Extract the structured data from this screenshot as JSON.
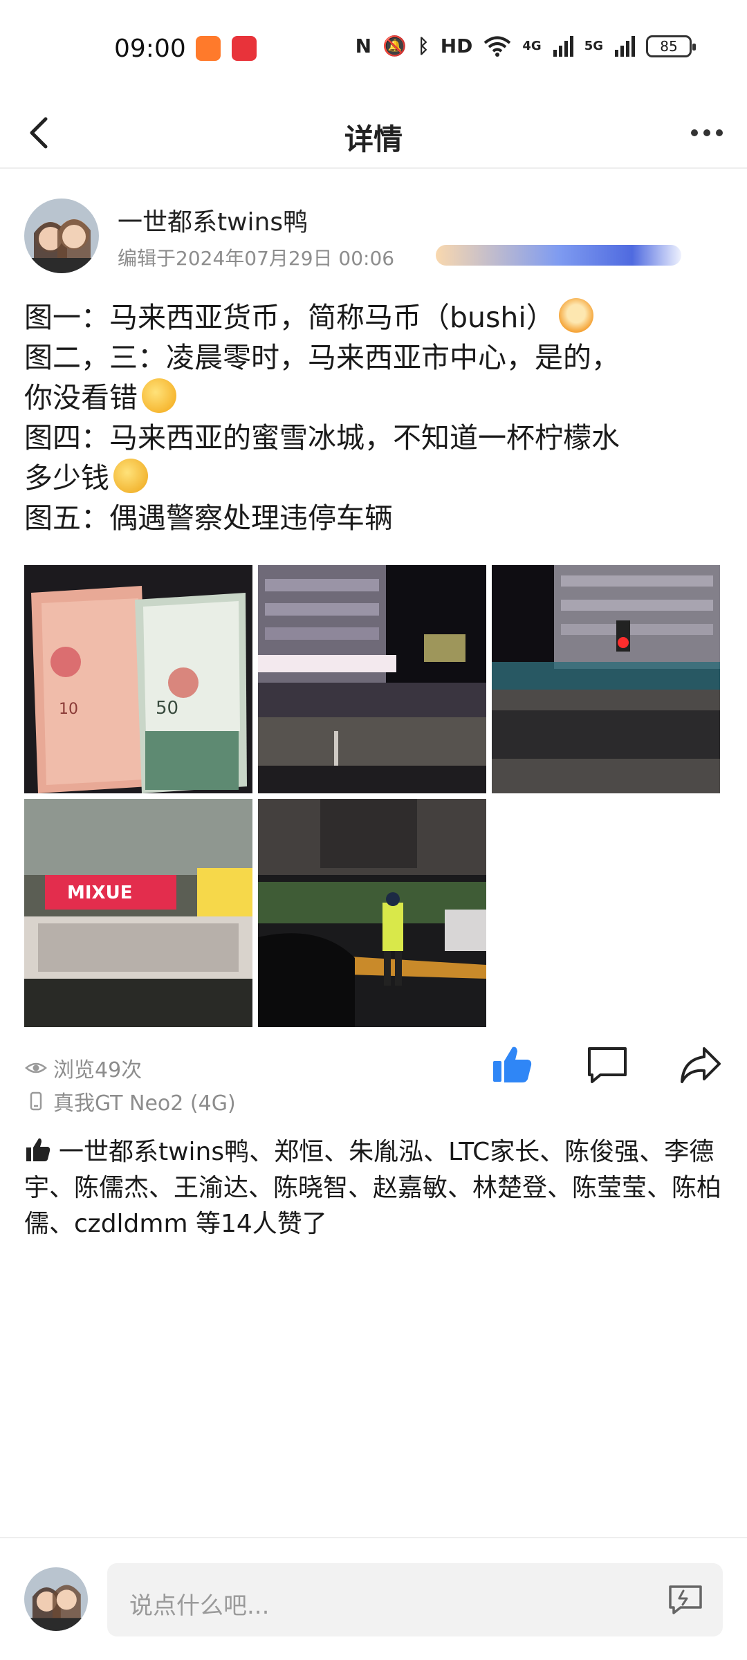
{
  "status_bar": {
    "time": "09:00",
    "network1": "4G",
    "network2": "5G",
    "hd": "HD",
    "battery": "85"
  },
  "nav": {
    "title": "详情"
  },
  "post": {
    "author": "一世都系twins鸭",
    "edit_time": "编辑于2024年07月29日 00:06",
    "lines": [
      "图一：马来西亚货币，简称马币（bushi）",
      "图二，三：凌晨零时，马来西亚市中心，是的，",
      "你没看错",
      "图四：马来西亚的蜜雪冰城，不知道一杯柠檬水",
      "多少钱",
      "图五：偶遇警察处理违停车辆"
    ],
    "photos": [
      {
        "name": "photo-malaysian-currency"
      },
      {
        "name": "photo-city-center-night-1"
      },
      {
        "name": "photo-city-center-night-2"
      },
      {
        "name": "photo-mixue-store",
        "sign": "MIXUE"
      },
      {
        "name": "photo-police-parking"
      }
    ],
    "views": "浏览49次",
    "device": "真我GT Neo2 (4G)",
    "likes_text": "一世都系twins鸭、郑恒、朱胤泓、LTC家长、陈俊强、李德宇、陈儒杰、王渝达、陈晓智、赵嘉敏、林楚登、陈莹莹、陈柏儒、czdldmm 等14人赞了"
  },
  "comment": {
    "placeholder": "说点什么吧..."
  },
  "colors": {
    "accent": "#2f86f6",
    "muted": "#8d8d8d",
    "input_bg": "#f2f2f2"
  }
}
